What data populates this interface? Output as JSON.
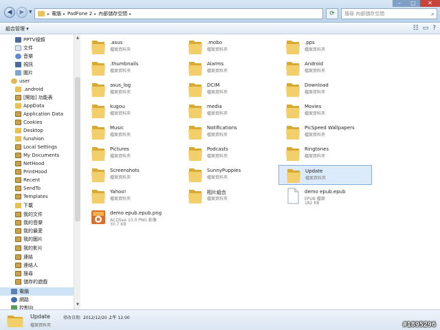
{
  "window": {
    "minimize": "–",
    "maximize": "□",
    "close": "✕"
  },
  "address": {
    "crumbs": [
      "電腦",
      "PadFone 2",
      "內部儲存空間"
    ],
    "sep": "▸",
    "search_placeholder": "搜尋 內部儲存空間"
  },
  "toolbar": {
    "organize": "組合管理 ▾"
  },
  "sidebar": {
    "items": [
      {
        "label": "PPTV視頻",
        "icon": "video"
      },
      {
        "label": "文件",
        "icon": "doc"
      },
      {
        "label": "音樂",
        "icon": "music"
      },
      {
        "label": "視訊",
        "icon": "video"
      },
      {
        "label": "圖片",
        "icon": "pic"
      },
      {
        "label": "user",
        "icon": "user"
      },
      {
        "label": ".android",
        "icon": "folder"
      },
      {
        "label": "[開始] 功能表",
        "icon": "special"
      },
      {
        "label": "AppData",
        "icon": "folder"
      },
      {
        "label": "Application Data",
        "icon": "special"
      },
      {
        "label": "Cookies",
        "icon": "special"
      },
      {
        "label": "Desktop",
        "icon": "folder"
      },
      {
        "label": "funshion",
        "icon": "folder"
      },
      {
        "label": "Local Settings",
        "icon": "special"
      },
      {
        "label": "My Documents",
        "icon": "special"
      },
      {
        "label": "NetHood",
        "icon": "special"
      },
      {
        "label": "PrintHood",
        "icon": "special"
      },
      {
        "label": "Recent",
        "icon": "special"
      },
      {
        "label": "SendTo",
        "icon": "special"
      },
      {
        "label": "Templates",
        "icon": "special"
      },
      {
        "label": "下載",
        "icon": "folder"
      },
      {
        "label": "我的文件",
        "icon": "special"
      },
      {
        "label": "我的音樂",
        "icon": "special"
      },
      {
        "label": "我的最愛",
        "icon": "special"
      },
      {
        "label": "我的圖片",
        "icon": "special"
      },
      {
        "label": "我的影片",
        "icon": "special"
      },
      {
        "label": "連結",
        "icon": "special"
      },
      {
        "label": "連絡人",
        "icon": "special"
      },
      {
        "label": "搜尋",
        "icon": "special"
      },
      {
        "label": "儲存的遊戲",
        "icon": "special"
      },
      {
        "label": "電腦",
        "icon": "computer"
      },
      {
        "label": "網路",
        "icon": "network"
      },
      {
        "label": "控制台",
        "icon": "control"
      }
    ]
  },
  "files": [
    {
      "name": ".asus",
      "type": "檔案資料夾",
      "kind": "folder"
    },
    {
      "name": ".mobo",
      "type": "檔案資料夾",
      "kind": "folder"
    },
    {
      "name": ".pps",
      "type": "檔案資料夾",
      "kind": "folder"
    },
    {
      "name": ".thumbnails",
      "type": "檔案資料夾",
      "kind": "folder"
    },
    {
      "name": "Alarms",
      "type": "檔案資料夾",
      "kind": "folder"
    },
    {
      "name": "Android",
      "type": "檔案資料夾",
      "kind": "folder"
    },
    {
      "name": "asus_log",
      "type": "檔案資料夾",
      "kind": "folder"
    },
    {
      "name": "DCIM",
      "type": "檔案資料夾",
      "kind": "folder"
    },
    {
      "name": "Download",
      "type": "檔案資料夾",
      "kind": "folder"
    },
    {
      "name": "kugou",
      "type": "檔案資料夾",
      "kind": "folder"
    },
    {
      "name": "media",
      "type": "檔案資料夾",
      "kind": "folder"
    },
    {
      "name": "Movies",
      "type": "檔案資料夾",
      "kind": "folder"
    },
    {
      "name": "Music",
      "type": "檔案資料夾",
      "kind": "folder"
    },
    {
      "name": "Notifications",
      "type": "檔案資料夾",
      "kind": "folder"
    },
    {
      "name": "PicSpeed Wallpapers",
      "type": "檔案資料夾",
      "kind": "folder"
    },
    {
      "name": "Pictures",
      "type": "檔案資料夾",
      "kind": "folder"
    },
    {
      "name": "Podcasts",
      "type": "檔案資料夾",
      "kind": "folder"
    },
    {
      "name": "Ringtones",
      "type": "檔案資料夾",
      "kind": "folder"
    },
    {
      "name": "Screenshots",
      "type": "檔案資料夾",
      "kind": "folder"
    },
    {
      "name": "SunnyPuppies",
      "type": "檔案資料夾",
      "kind": "folder"
    },
    {
      "name": "Update",
      "type": "檔案資料夾",
      "kind": "folder",
      "selected": true
    },
    {
      "name": "Yahoo!",
      "type": "檔案資料夾",
      "kind": "folder"
    },
    {
      "name": "相片組合",
      "type": "檔案資料夾",
      "kind": "folder"
    },
    {
      "name": "demo epub.epub",
      "type": "EPUB 檔案",
      "size": "182 KB",
      "kind": "file"
    },
    {
      "name": "demo epub.epub.png",
      "type": "ACDSee 10.0 PNG 影像",
      "size": "30.7 KB",
      "kind": "png"
    }
  ],
  "details": {
    "name": "Update",
    "type": "檔案資料夾",
    "modified_label": "修改日期:",
    "modified_value": "2012/12/20 上午 12:00"
  },
  "watermark": "#1895296",
  "colors": {
    "folder": "#f2cf6b",
    "selection": "#dcebfc",
    "accent": "#3b5f8d"
  }
}
